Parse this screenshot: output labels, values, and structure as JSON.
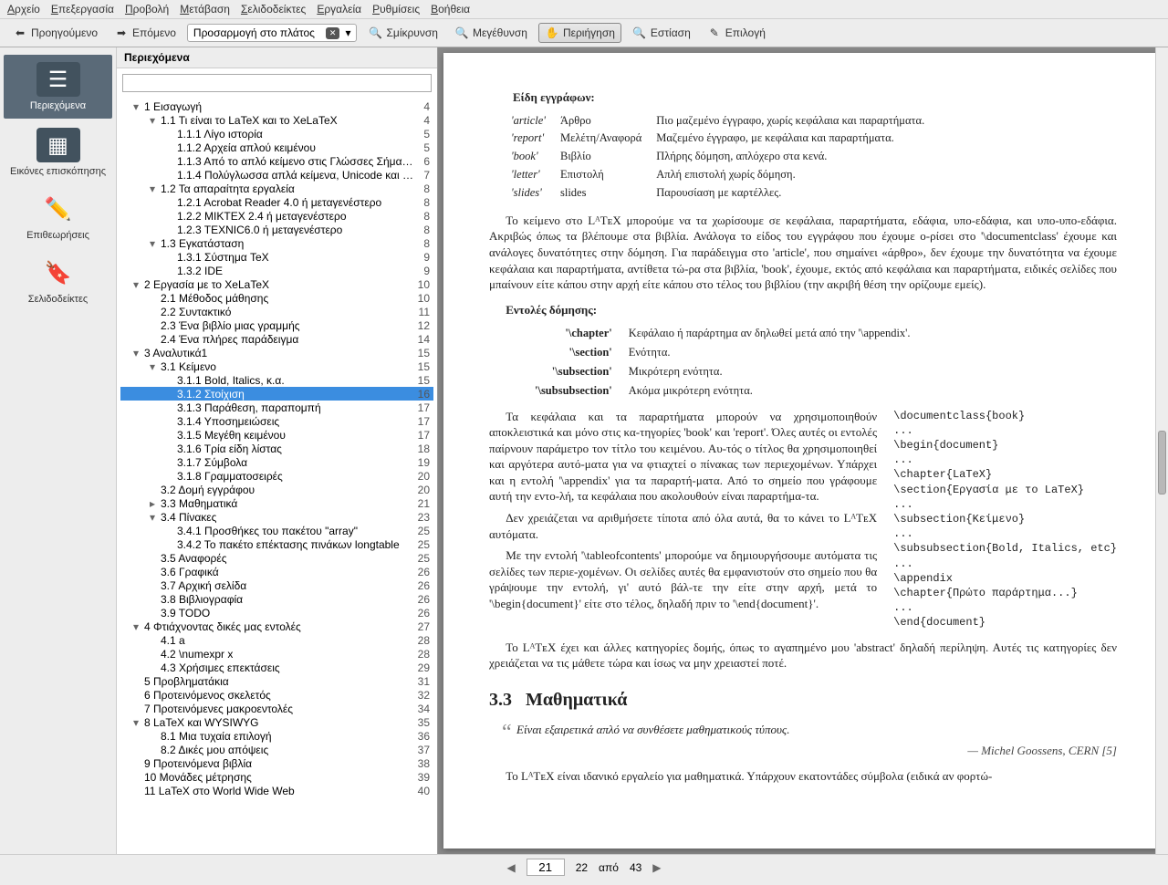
{
  "menu": [
    "Αρχείο",
    "Επεξεργασία",
    "Προβολή",
    "Μετάβαση",
    "Σελιδοδείκτες",
    "Εργαλεία",
    "Ρυθμίσεις",
    "Βοήθεια"
  ],
  "menu_underline": [
    0,
    0,
    0,
    0,
    0,
    0,
    0,
    0
  ],
  "toolbar": {
    "prev": "Προηγούμενο",
    "next": "Επόμενο",
    "fitmode": "Προσαρμογή στο πλάτος",
    "zoomout": "Σμίκρυνση",
    "zoomin": "Μεγέθυνση",
    "browse": "Περιήγηση",
    "focus": "Εστίαση",
    "selection": "Επιλογή"
  },
  "sidebar": {
    "items": [
      {
        "label": "Περιεχόμενα"
      },
      {
        "label": "Εικόνες επισκόπησης"
      },
      {
        "label": "Επιθεωρήσεις"
      },
      {
        "label": "Σελιδοδείκτες"
      }
    ]
  },
  "toc_title": "Περιεχόμενα",
  "toc_search_placeholder": "",
  "toc": [
    {
      "l": 0,
      "e": "▾",
      "t": "1 Εισαγωγή",
      "p": "4"
    },
    {
      "l": 1,
      "e": "▾",
      "t": "1.1 Τι είναι το LaTeX και το XeLaTeX",
      "p": "4"
    },
    {
      "l": 2,
      "e": "",
      "t": "1.1.1 Λίγο ιστορία",
      "p": "5"
    },
    {
      "l": 2,
      "e": "",
      "t": "1.1.2 Αρχεία απλού κειμένου",
      "p": "5"
    },
    {
      "l": 2,
      "e": "",
      "t": "1.1.3 Από το απλό κείμενο στις Γλώσσες Σήμα…",
      "p": "6"
    },
    {
      "l": 2,
      "e": "",
      "t": "1.1.4 Πολύγλωσσα απλά κείμενα, Unicode και …",
      "p": "7"
    },
    {
      "l": 1,
      "e": "▾",
      "t": "1.2 Τα απαραίτητα εργαλεία",
      "p": "8"
    },
    {
      "l": 2,
      "e": "",
      "t": "1.2.1 Acrobat Reader 4.0 ή μεταγενέστερο",
      "p": "8"
    },
    {
      "l": 2,
      "e": "",
      "t": "1.2.2 MIKTEX 2.4 ή μεταγενέστερο",
      "p": "8"
    },
    {
      "l": 2,
      "e": "",
      "t": "1.2.3 TEXNIC6.0 ή μεταγενέστερο",
      "p": "8"
    },
    {
      "l": 1,
      "e": "▾",
      "t": "1.3 Εγκατάσταση",
      "p": "8"
    },
    {
      "l": 2,
      "e": "",
      "t": "1.3.1 Σύστημα TeX",
      "p": "9"
    },
    {
      "l": 2,
      "e": "",
      "t": "1.3.2 IDE",
      "p": "9"
    },
    {
      "l": 0,
      "e": "▾",
      "t": "2 Εργασία με το XeLaTeX",
      "p": "10"
    },
    {
      "l": 1,
      "e": "",
      "t": "2.1 Μέθοδος μάθησης",
      "p": "10"
    },
    {
      "l": 1,
      "e": "",
      "t": "2.2 Συντακτικό",
      "p": "11"
    },
    {
      "l": 1,
      "e": "",
      "t": "2.3 Ένα βιβλίο μιας γραμμής",
      "p": "12"
    },
    {
      "l": 1,
      "e": "",
      "t": "2.4 Ένα πλήρες παράδειγμα",
      "p": "14"
    },
    {
      "l": 0,
      "e": "▾",
      "t": "3 Αναλυτικά1",
      "p": "15"
    },
    {
      "l": 1,
      "e": "▾",
      "t": "3.1 Κείμενο",
      "p": "15"
    },
    {
      "l": 2,
      "e": "",
      "t": "3.1.1 Bold, Italics, κ.α.",
      "p": "15"
    },
    {
      "l": 2,
      "e": "",
      "t": "3.1.2 Στοίχιση",
      "p": "16",
      "sel": true
    },
    {
      "l": 2,
      "e": "",
      "t": "3.1.3 Παράθεση, παραπομπή",
      "p": "17"
    },
    {
      "l": 2,
      "e": "",
      "t": "3.1.4 Υποσημειώσεις",
      "p": "17"
    },
    {
      "l": 2,
      "e": "",
      "t": "3.1.5 Μεγέθη κειμένου",
      "p": "17"
    },
    {
      "l": 2,
      "e": "",
      "t": "3.1.6 Τρία είδη λίστας",
      "p": "18"
    },
    {
      "l": 2,
      "e": "",
      "t": "3.1.7 Σύμβολα",
      "p": "19"
    },
    {
      "l": 2,
      "e": "",
      "t": "3.1.8 Γραμματοσειρές",
      "p": "20"
    },
    {
      "l": 1,
      "e": "",
      "t": "3.2 Δομή εγγράφου",
      "p": "20"
    },
    {
      "l": 1,
      "e": "▸",
      "t": "3.3 Μαθηματικά",
      "p": "21"
    },
    {
      "l": 1,
      "e": "▾",
      "t": "3.4 Πίνακες",
      "p": "23"
    },
    {
      "l": 2,
      "e": "",
      "t": "3.4.1 Προσθήκες του πακέτου \"array\"",
      "p": "25"
    },
    {
      "l": 2,
      "e": "",
      "t": "3.4.2 Το πακέτο επέκτασης πινάκων longtable",
      "p": "25"
    },
    {
      "l": 1,
      "e": "",
      "t": "3.5 Αναφορές",
      "p": "25"
    },
    {
      "l": 1,
      "e": "",
      "t": "3.6 Γραφικά",
      "p": "26"
    },
    {
      "l": 1,
      "e": "",
      "t": "3.7 Αρχική σελίδα",
      "p": "26"
    },
    {
      "l": 1,
      "e": "",
      "t": "3.8 Βιβλιογραφία",
      "p": "26"
    },
    {
      "l": 1,
      "e": "",
      "t": "3.9 TODO",
      "p": "26"
    },
    {
      "l": 0,
      "e": "▾",
      "t": "4 Φτιάχνοντας δικές μας εντολές",
      "p": "27"
    },
    {
      "l": 1,
      "e": "",
      "t": "4.1 a",
      "p": "28"
    },
    {
      "l": 1,
      "e": "",
      "t": "4.2 \\numexpr x",
      "p": "28"
    },
    {
      "l": 1,
      "e": "",
      "t": "4.3 Χρήσιμες επεκτάσεις",
      "p": "29"
    },
    {
      "l": 0,
      "e": "",
      "t": "5 Προβληματάκια",
      "p": "31"
    },
    {
      "l": 0,
      "e": "",
      "t": "6 Προτεινόμενος σκελετός",
      "p": "32"
    },
    {
      "l": 0,
      "e": "",
      "t": "7 Προτεινόμενες μακροεντολές",
      "p": "34"
    },
    {
      "l": 0,
      "e": "▾",
      "t": "8 LaTeX και WYSIWYG",
      "p": "35"
    },
    {
      "l": 1,
      "e": "",
      "t": "8.1 Μια τυχαία επιλογή",
      "p": "36"
    },
    {
      "l": 1,
      "e": "",
      "t": "8.2 Δικές μου απόψεις",
      "p": "37"
    },
    {
      "l": 0,
      "e": "",
      "t": "9 Προτεινόμενα βιβλία",
      "p": "38"
    },
    {
      "l": 0,
      "e": "",
      "t": "10 Μονάδες μέτρησης",
      "p": "39"
    },
    {
      "l": 0,
      "e": "",
      "t": "11 LaTeX στο World Wide Web",
      "p": "40"
    }
  ],
  "doc": {
    "types_heading": "Είδη εγγράφων:",
    "types": [
      [
        "'article'",
        "Άρθρο",
        "Πιο μαζεμένο έγγραφο, χωρίς κεφάλαια και παραρτήματα."
      ],
      [
        "'report'",
        "Μελέτη/Αναφορά",
        "Μαζεμένο έγγραφο, με κεφάλαια και παραρτήματα."
      ],
      [
        "'book'",
        "Βιβλίο",
        "Πλήρης δόμηση, απλόχερο στα κενά."
      ],
      [
        "'letter'",
        "Επιστολή",
        "Απλή επιστολή χωρίς δόμηση."
      ],
      [
        "'slides'",
        "slides",
        "Παρουσίαση με καρτέλλες."
      ]
    ],
    "para1": "Το κείμενο στο LᴬTᴇX μπορούμε να τα χωρίσουμε σε κεφάλαια, παραρτήματα, εδάφια, υπο-εδάφια, και υπο-υπο-εδάφια. Ακριβώς όπως τα βλέπουμε στα βιβλία. Ανάλογα το είδος του εγγράφου που έχουμε ο-ρίσει στο '\\documentclass' έχουμε και ανάλογες δυνατότητες στην δόμηση. Για παράδειγμα στο 'article', που σημαίνει «άρθρο», δεν έχουμε την δυνατότητα να έχουμε κεφάλαια και παραρτήματα, αντίθετα τώ-ρα στα βιβλία, 'book', έχουμε, εκτός από κεφάλαια και παραρτήματα, ειδικές σελίδες που μπαίνουν είτε κάπου στην αρχή είτε κάπου στο τέλος του βιβλίου (την ακριβή θέση την ορίζουμε εμείς).",
    "cmds_heading": "Εντολές δόμησης:",
    "cmds": [
      [
        "'\\chapter'",
        "Κεφάλαιο ή παράρτημα αν δηλωθεί μετά από την '\\appendix'."
      ],
      [
        "'\\section'",
        "Ενότητα."
      ],
      [
        "'\\subsection'",
        "Μικρότερη ενότητα."
      ],
      [
        "'\\subsubsection'",
        "Ακόμα μικρότερη ενότητα."
      ]
    ],
    "col_left": [
      "Τα κεφάλαια και τα παραρτήματα μπορούν να χρησιμοποιηθούν αποκλειστικά και μόνο στις κα-τηγορίες 'book' και 'report'. Όλες αυτές οι εντολές παίρνουν παράμετρο τον τίτλο του κειμένου. Αυ-τός ο τίτλος θα χρησιμοποιηθεί και αργότερα αυτό-ματα για να φτιαχτεί ο πίνακας των περιεχομένων. Υπάρχει και η εντολή '\\appendix' για τα παραρτή-ματα. Από το σημείο που γράφουμε αυτή την εντο-λή, τα κεφάλαια που ακολουθούν είναι παραρτήμα-τα.",
      "Δεν χρειάζεται να αριθμήσετε τίποτα από όλα αυτά, θα το κάνει το LᴬTᴇX αυτόματα.",
      "Με την εντολή '\\tableofcontents' μπορούμε να δημιουργήσουμε αυτόματα τις σελίδες των περιε-χομένων. Οι σελίδες αυτές θα εμφανιστούν στο σημείο που θα γράψουμε την εντολή, γι' αυτό βάλ-τε την είτε στην αρχή, μετά το '\\begin{document}' είτε στο τέλος, δηλαδή πριν το '\\end{document}'."
    ],
    "col_right": "\\documentclass{book}\n...\n\\begin{document}\n...\n\\chapter{LaTeX}\n\\section{Εργασία με το LaTeX}\n...\n\\subsection{Κείμενο}\n...\n\\subsubsection{Bold, Italics, etc}\n...\n\\appendix\n\\chapter{Πρώτο παράρτημα...}\n...\n\\end{document}",
    "para2": "Το LᴬTᴇX έχει και άλλες κατηγορίες δομής, όπως το αγαπημένο μου 'abstract' δηλαδή περίληψη. Αυτές τις κατηγορίες δεν χρειάζεται να τις μάθετε τώρα και ίσως να μην χρειαστεί ποτέ.",
    "sec33_num": "3.3",
    "sec33_title": "Μαθηματικά",
    "quote": "Είναι εξαιρετικά απλό να συνθέσετε μαθηματικούς τύπους.",
    "attribution": "— Michel Goossens, CERN [5]",
    "para3": "Το LᴬTᴇX είναι ιδανικό εργαλείο για μαθηματικά. Υπάρχουν εκατοντάδες σύμβολα (ειδικά αν φορτώ-"
  },
  "status": {
    "page_current": "21",
    "page_next": "22",
    "of_label": "από",
    "total": "43"
  }
}
